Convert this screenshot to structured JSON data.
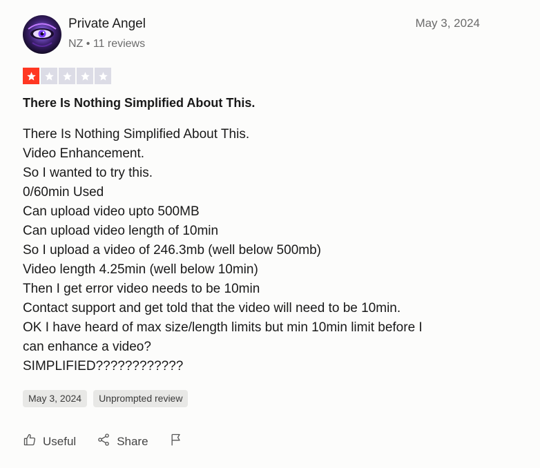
{
  "reviewer": {
    "name": "Private Angel",
    "meta": "NZ • 11 reviews",
    "avatar_icon": "avatar-eye-portrait"
  },
  "review": {
    "date": "May 3, 2024",
    "rating": 1,
    "rating_max": 5,
    "star_fill_color": "#ff3722",
    "star_empty_color": "#dcdce6",
    "title": "There Is Nothing Simplified About This.",
    "body_lines": [
      "There Is Nothing Simplified About This.",
      "Video Enhancement.",
      "So I wanted to try this.",
      "0/60min Used",
      "Can upload video upto 500MB",
      "Can upload video length of 10min",
      "So I upload a video of 246.3mb (well below 500mb)",
      "Video length 4.25min (well below 10min)",
      "Then I get error video needs to be 10min",
      "Contact support and get told that the video will need to be 10min.",
      "OK I have heard of max size/length limits but min 10min limit before I",
      "can enhance a video?",
      "SIMPLIFIED????????????"
    ],
    "tags": [
      "May 3, 2024",
      "Unprompted review"
    ]
  },
  "actions": {
    "useful_label": "Useful",
    "share_label": "Share",
    "useful_icon": "thumbs-up-icon",
    "share_icon": "share-icon",
    "flag_icon": "flag-icon"
  }
}
